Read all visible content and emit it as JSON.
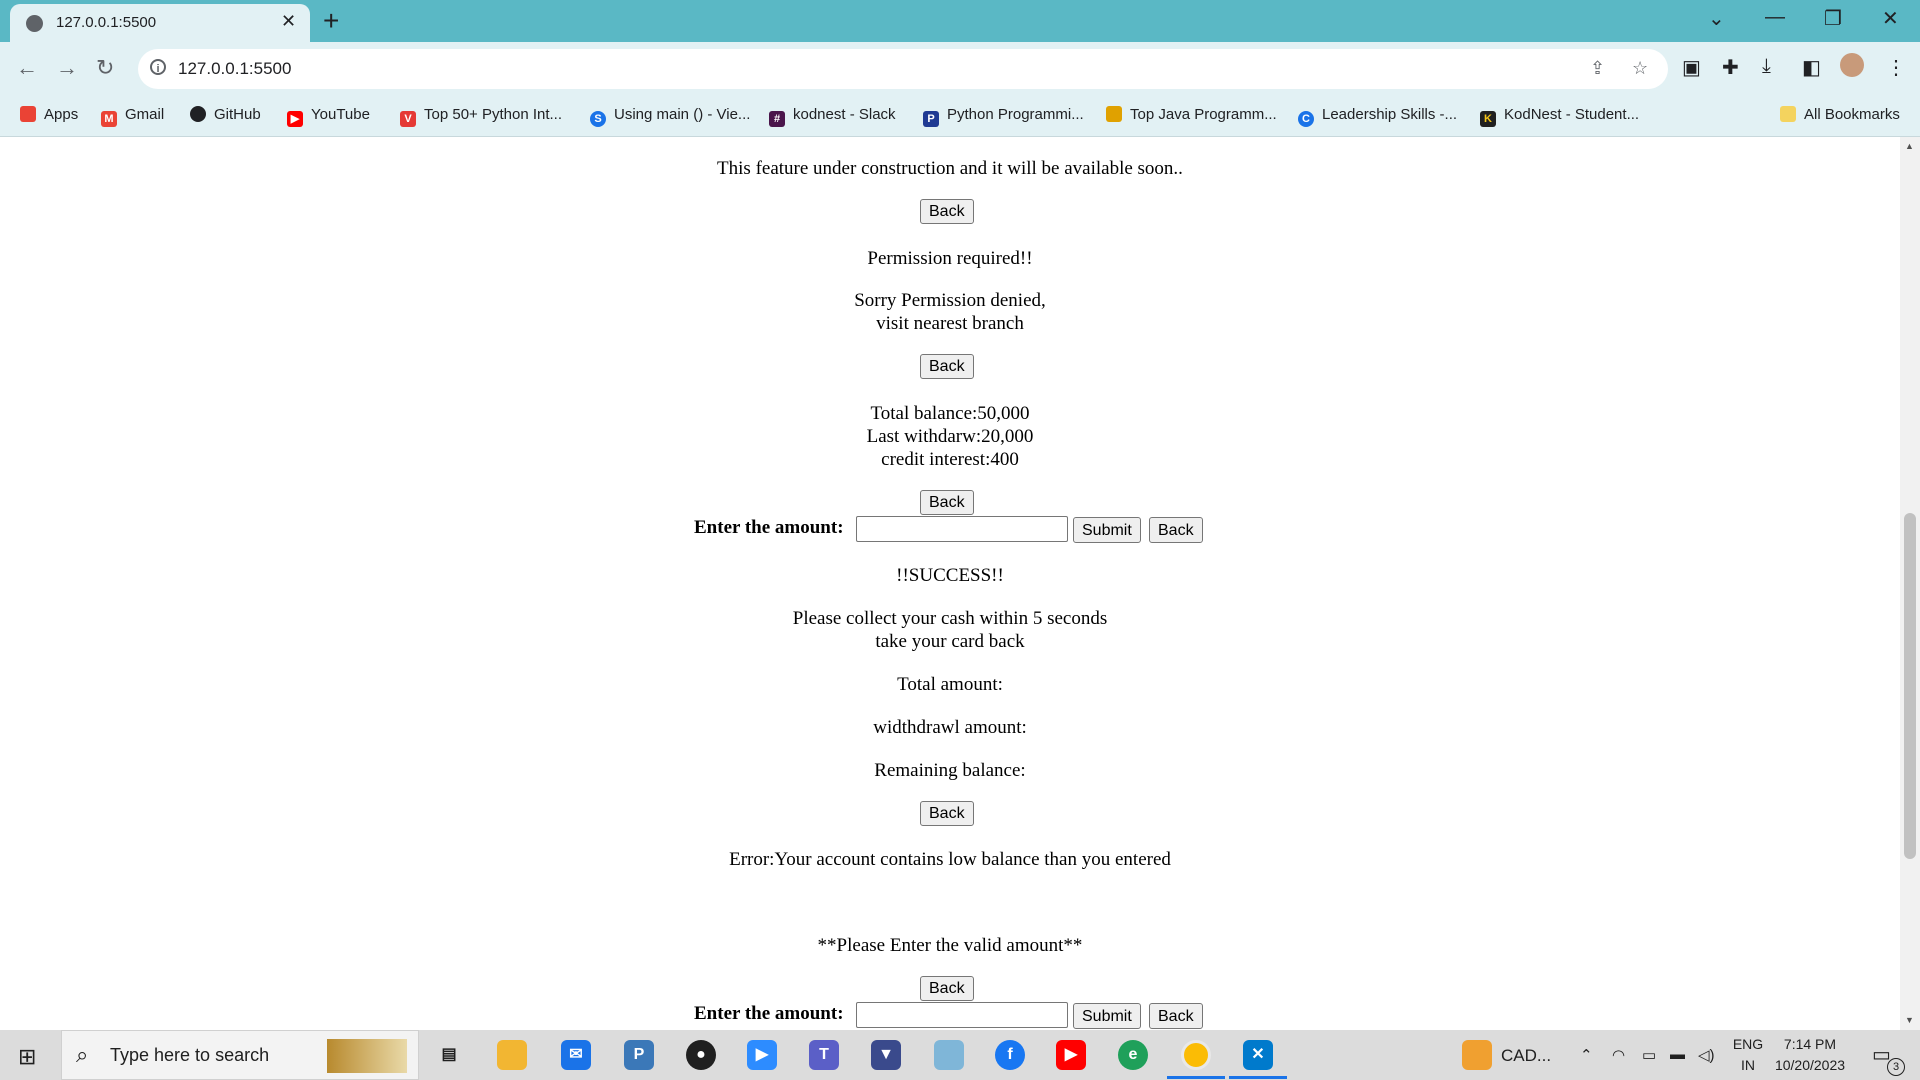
{
  "browser": {
    "tab_title": "127.0.0.1:5500",
    "url": "127.0.0.1:5500",
    "bookmarks": [
      {
        "label": "Apps",
        "color": "#ea4335"
      },
      {
        "label": "Gmail",
        "color": "#ea4335"
      },
      {
        "label": "GitHub",
        "color": "#202124"
      },
      {
        "label": "YouTube",
        "color": "#ff0000"
      },
      {
        "label": "Top 50+ Python Int...",
        "color": "#e53935"
      },
      {
        "label": "Using main () - Vie...",
        "color": "#1a73e8"
      },
      {
        "label": "kodnest - Slack",
        "color": "#4a154b"
      },
      {
        "label": "Python Programmi...",
        "color": "#1f3a93"
      },
      {
        "label": "Top Java Programm...",
        "color": "#e0a100"
      },
      {
        "label": "Leadership Skills -...",
        "color": "#1a73e8"
      },
      {
        "label": "KodNest - Student...",
        "color": "#202020"
      }
    ],
    "all_bookmarks": "All Bookmarks"
  },
  "page": {
    "construction_msg": "This feature under construction and it will be available soon..",
    "back_label": "Back",
    "submit_label": "Submit",
    "permission_title": "Permission required!!",
    "permission_line1": "Sorry Permission denied,",
    "permission_line2": "visit nearest branch",
    "balance_line1": "Total balance:50,000",
    "balance_line2": "Last withdarw:20,000",
    "balance_line3": "credit interest:400",
    "amount_label": "Enter the amount:",
    "success_title": "!!SUCCESS!!",
    "success_line1": "Please collect your cash within 5 seconds",
    "success_line2": "take your card back",
    "total_amount": "Total amount:",
    "withdraw_amount": "widthdrawl amount:",
    "remaining_balance": "Remaining balance:",
    "error_msg": "Error:Your account contains low balance than you entered",
    "valid_amount_msg": "**Please Enter the valid amount**"
  },
  "taskbar": {
    "search_placeholder": "Type here to search",
    "cad_label": "CAD...",
    "lang_line1": "ENG",
    "lang_line2": "IN",
    "time": "7:14 PM",
    "date": "10/20/2023",
    "notification_count": "3"
  }
}
